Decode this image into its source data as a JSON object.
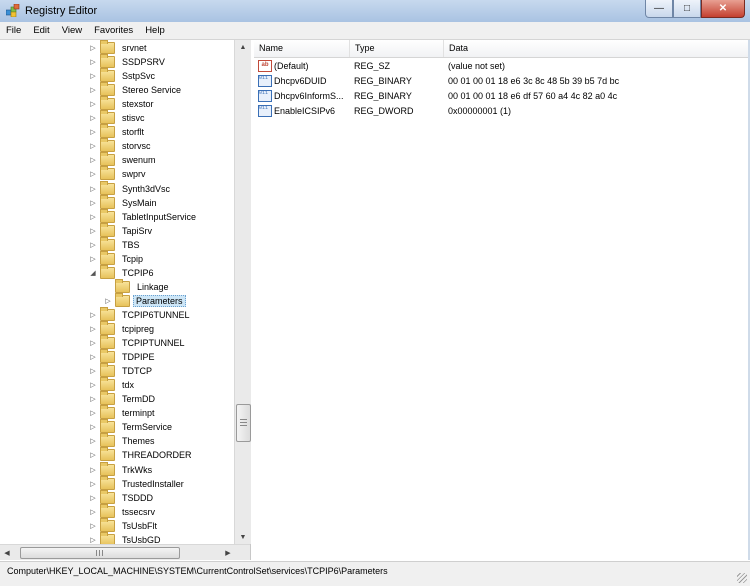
{
  "window": {
    "title": "Registry Editor",
    "minimize": "—",
    "maximize": "□",
    "close": "✕"
  },
  "menu": [
    "File",
    "Edit",
    "View",
    "Favorites",
    "Help"
  ],
  "tree": {
    "items": [
      {
        "label": "srvnet",
        "expanded": false,
        "depth": 0
      },
      {
        "label": "SSDPSRV",
        "expanded": false,
        "depth": 0
      },
      {
        "label": "SstpSvc",
        "expanded": false,
        "depth": 0
      },
      {
        "label": "Stereo Service",
        "expanded": false,
        "depth": 0
      },
      {
        "label": "stexstor",
        "expanded": false,
        "depth": 0
      },
      {
        "label": "stisvc",
        "expanded": false,
        "depth": 0
      },
      {
        "label": "storflt",
        "expanded": false,
        "depth": 0
      },
      {
        "label": "storvsc",
        "expanded": false,
        "depth": 0
      },
      {
        "label": "swenum",
        "expanded": false,
        "depth": 0
      },
      {
        "label": "swprv",
        "expanded": false,
        "depth": 0
      },
      {
        "label": "Synth3dVsc",
        "expanded": false,
        "depth": 0
      },
      {
        "label": "SysMain",
        "expanded": false,
        "depth": 0
      },
      {
        "label": "TabletInputService",
        "expanded": false,
        "depth": 0
      },
      {
        "label": "TapiSrv",
        "expanded": false,
        "depth": 0
      },
      {
        "label": "TBS",
        "expanded": false,
        "depth": 0
      },
      {
        "label": "Tcpip",
        "expanded": false,
        "depth": 0
      },
      {
        "label": "TCPIP6",
        "expanded": true,
        "depth": 0
      },
      {
        "label": "Linkage",
        "expanded": false,
        "depth": 1,
        "leaf": true
      },
      {
        "label": "Parameters",
        "expanded": false,
        "depth": 1,
        "selected": true
      },
      {
        "label": "TCPIP6TUNNEL",
        "expanded": false,
        "depth": 0
      },
      {
        "label": "tcpipreg",
        "expanded": false,
        "depth": 0
      },
      {
        "label": "TCPIPTUNNEL",
        "expanded": false,
        "depth": 0
      },
      {
        "label": "TDPIPE",
        "expanded": false,
        "depth": 0
      },
      {
        "label": "TDTCP",
        "expanded": false,
        "depth": 0
      },
      {
        "label": "tdx",
        "expanded": false,
        "depth": 0
      },
      {
        "label": "TermDD",
        "expanded": false,
        "depth": 0
      },
      {
        "label": "terminpt",
        "expanded": false,
        "depth": 0
      },
      {
        "label": "TermService",
        "expanded": false,
        "depth": 0
      },
      {
        "label": "Themes",
        "expanded": false,
        "depth": 0
      },
      {
        "label": "THREADORDER",
        "expanded": false,
        "depth": 0
      },
      {
        "label": "TrkWks",
        "expanded": false,
        "depth": 0
      },
      {
        "label": "TrustedInstaller",
        "expanded": false,
        "depth": 0
      },
      {
        "label": "TSDDD",
        "expanded": false,
        "depth": 0
      },
      {
        "label": "tssecsrv",
        "expanded": false,
        "depth": 0
      },
      {
        "label": "TsUsbFlt",
        "expanded": false,
        "depth": 0
      },
      {
        "label": "TsUsbGD",
        "expanded": false,
        "depth": 0
      }
    ]
  },
  "values": {
    "columns": [
      "Name",
      "Type",
      "Data"
    ],
    "rows": [
      {
        "icon": "string-value-icon",
        "name": "(Default)",
        "type": "REG_SZ",
        "data": "(value not set)"
      },
      {
        "icon": "binary-value-icon",
        "name": "Dhcpv6DUID",
        "type": "REG_BINARY",
        "data": "00 01 00 01 18 e6 3c 8c 48 5b 39 b5 7d bc"
      },
      {
        "icon": "binary-value-icon",
        "name": "Dhcpv6InformS...",
        "type": "REG_BINARY",
        "data": "00 01 00 01 18 e6 df 57 60 a4 4c 82 a0 4c"
      },
      {
        "icon": "binary-value-icon",
        "name": "EnableICSIPv6",
        "type": "REG_DWORD",
        "data": "0x00000001 (1)"
      }
    ]
  },
  "status": {
    "path": "Computer\\HKEY_LOCAL_MACHINE\\SYSTEM\\CurrentControlSet\\services\\TCPIP6\\Parameters"
  },
  "icons": {
    "ab_glyph": "ab",
    "bin_glyph": "011 110"
  },
  "colors": {
    "selection": "#cde6f7",
    "folder": "#e7c25b"
  }
}
